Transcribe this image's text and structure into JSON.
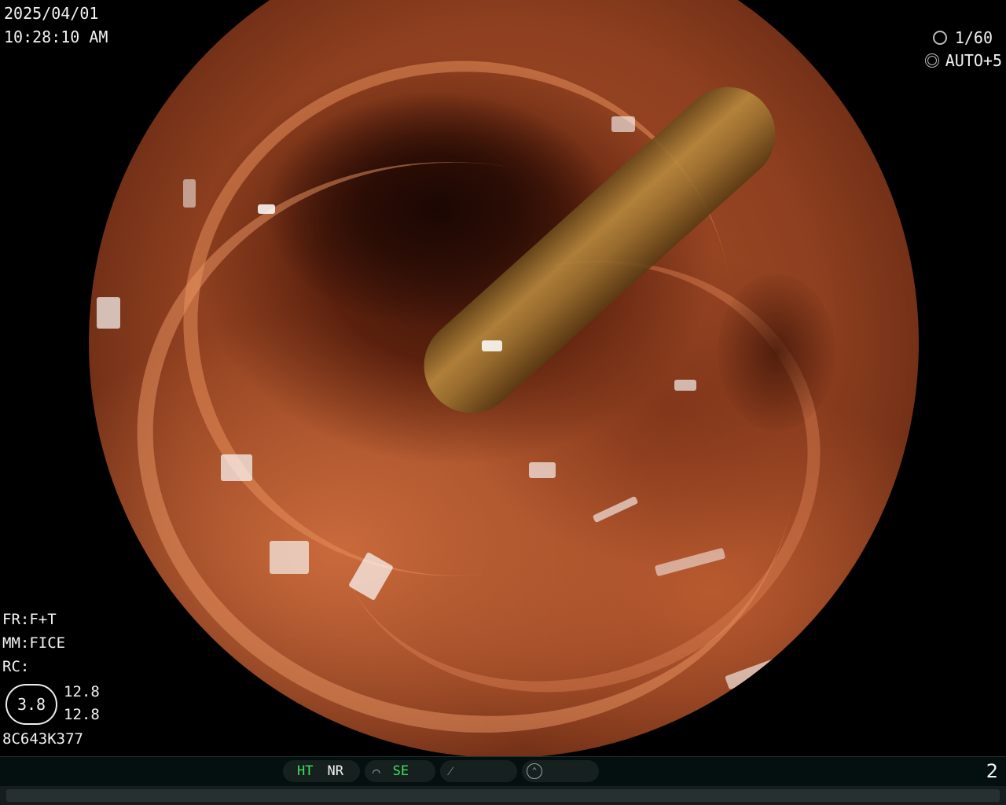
{
  "overlay": {
    "date": "2025/04/01",
    "time": "10:28:10  AM",
    "shutter": "1/60",
    "iris": "AUTO+5",
    "fr": "FR:F+T",
    "mm": "MM:FICE",
    "rc": "RC:",
    "oval_value": "3.8",
    "value_top": "12.8",
    "value_bottom": "12.8",
    "device_code": "8C643K377"
  },
  "statusbar": {
    "ht": "HT",
    "nr": "NR",
    "se": "SE",
    "page_number": "2"
  },
  "icons": {
    "shutter": "shutter-icon",
    "iris": "iris-icon",
    "curve": "curve-icon",
    "slash": "slash-icon",
    "pump": "pump-icon"
  },
  "colors": {
    "mode_active": "#3ee05a",
    "overlay_text": "#f2f2f2",
    "bar_background": "#04100f"
  }
}
